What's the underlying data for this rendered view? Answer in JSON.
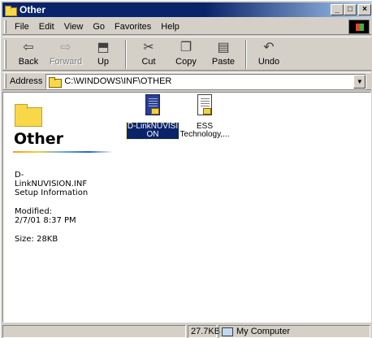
{
  "window": {
    "title": "Other",
    "buttons": {
      "minimize": "_",
      "maximize": "□",
      "close": "×"
    }
  },
  "menu": [
    {
      "label": "File"
    },
    {
      "label": "Edit"
    },
    {
      "label": "View"
    },
    {
      "label": "Go"
    },
    {
      "label": "Favorites"
    },
    {
      "label": "Help"
    }
  ],
  "toolbar": {
    "back": "Back",
    "forward": "Forward",
    "up": "Up",
    "cut": "Cut",
    "copy": "Copy",
    "paste": "Paste",
    "undo": "Undo"
  },
  "address": {
    "label": "Address",
    "value": "C:\\WINDOWS\\INF\\OTHER"
  },
  "infopane": {
    "title": "Other",
    "filename_line1": "D-",
    "filename_line2": "LinkNUVISION.INF",
    "filetype": "Setup Information",
    "modified_label": "Modified:",
    "modified_value": "2/7/01 8:37 PM",
    "size": "Size: 28KB"
  },
  "files": [
    {
      "label_line1": "D-LinkNUVISI",
      "label_line2": "ON",
      "selected": true,
      "icon": "setup-information-icon"
    },
    {
      "label_line1": "ESS",
      "label_line2": "Technology,...",
      "selected": false,
      "icon": "setup-information-icon"
    }
  ],
  "status": {
    "panel1": "",
    "size": "27.7KB",
    "zone": "My Computer"
  }
}
